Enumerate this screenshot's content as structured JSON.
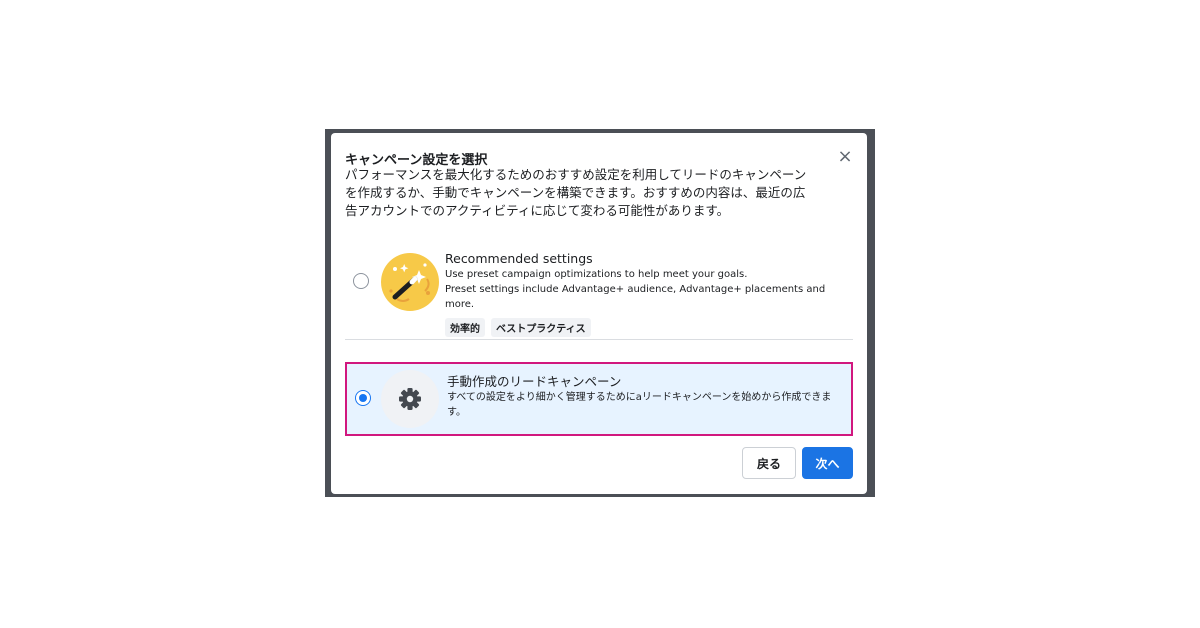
{
  "dialog": {
    "title": "キャンペーン設定を選択",
    "description": "パフォーマンスを最大化するためのおすすめ設定を利用してリードのキャンペーンを作成するか、手動でキャンペーンを構築できます。おすすめの内容は、最近の広告アカウントでのアクティビティに応じて変わる可能性があります。",
    "close_icon": "×"
  },
  "options": [
    {
      "title": "Recommended settings",
      "lines": [
        "Use preset campaign optimizations to help meet your goals.",
        "Preset settings include Advantage+ audience, Advantage+ placements and more."
      ],
      "tags": [
        "効率的",
        "ベストプラクティス"
      ],
      "icon": "magic-wand-icon",
      "selected": false
    },
    {
      "title": "手動作成のリードキャンペーン",
      "description": "すべての設定をより細かく管理するためにaリードキャンペーンを始めから作成できます。",
      "icon": "gear-icon",
      "selected": true
    }
  ],
  "buttons": {
    "back": "戻る",
    "next": "次へ"
  },
  "colors": {
    "primary": "#1b74e4",
    "selected_bg": "#e7f3ff",
    "highlight_border": "#d1177e",
    "backdrop": "#4b4f56"
  }
}
